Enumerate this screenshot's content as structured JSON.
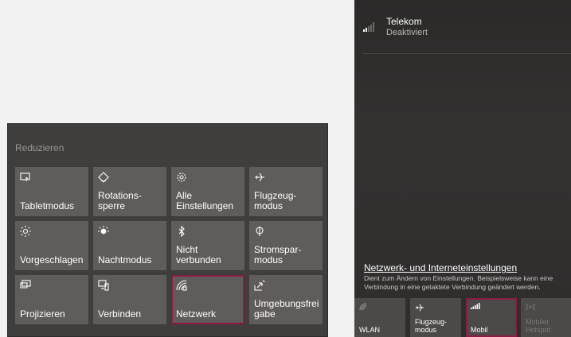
{
  "action_center": {
    "collapse_label": "Reduzieren",
    "tiles": [
      {
        "label": "Tabletmodus",
        "icon": "tablet-mode-icon"
      },
      {
        "label": "Rotations-\nsperre",
        "icon": "rotation-lock-icon"
      },
      {
        "label": "Alle\nEinstellungen",
        "icon": "settings-gear-icon"
      },
      {
        "label": "Flugzeug-\nmodus",
        "icon": "airplane-icon"
      },
      {
        "label": "Vorgeschlagen",
        "icon": "brightness-icon"
      },
      {
        "label": "Nachtmodus",
        "icon": "night-light-icon"
      },
      {
        "label": "Nicht\nverbunden",
        "icon": "bluetooth-icon"
      },
      {
        "label": "Stromspar-\nmodus",
        "icon": "battery-saver-icon"
      },
      {
        "label": "Projizieren",
        "icon": "project-icon"
      },
      {
        "label": "Verbinden",
        "icon": "connect-icon"
      },
      {
        "label": "Netzwerk",
        "icon": "network-icon",
        "selected": true
      },
      {
        "label": "Umgebungsfrei\ngabe",
        "icon": "nearby-sharing-icon"
      }
    ]
  },
  "network_flyout": {
    "carrier_name": "Telekom",
    "carrier_status": "Deaktiviert",
    "settings_link": "Netzwerk- und Interneteinstellungen",
    "settings_description": "Dient zum Ändern von Einstellungen. Beispielsweise kann eine Verbindung in eine getaktete Verbindung geändert werden.",
    "quick_tiles": [
      {
        "label": "WLAN",
        "icon": "wifi-icon"
      },
      {
        "label": "Flugzeug-\nmodus",
        "icon": "airplane-icon"
      },
      {
        "label": "Mobil",
        "icon": "cellular-icon",
        "selected": true
      },
      {
        "label": "Mobiler\nHotspot",
        "icon": "mobile-hotspot-icon",
        "disabled": true
      }
    ]
  },
  "colors": {
    "selection_border": "#8b1c44",
    "tile_background": "#5f5d5b",
    "panel_background": "#3f3e3c"
  }
}
